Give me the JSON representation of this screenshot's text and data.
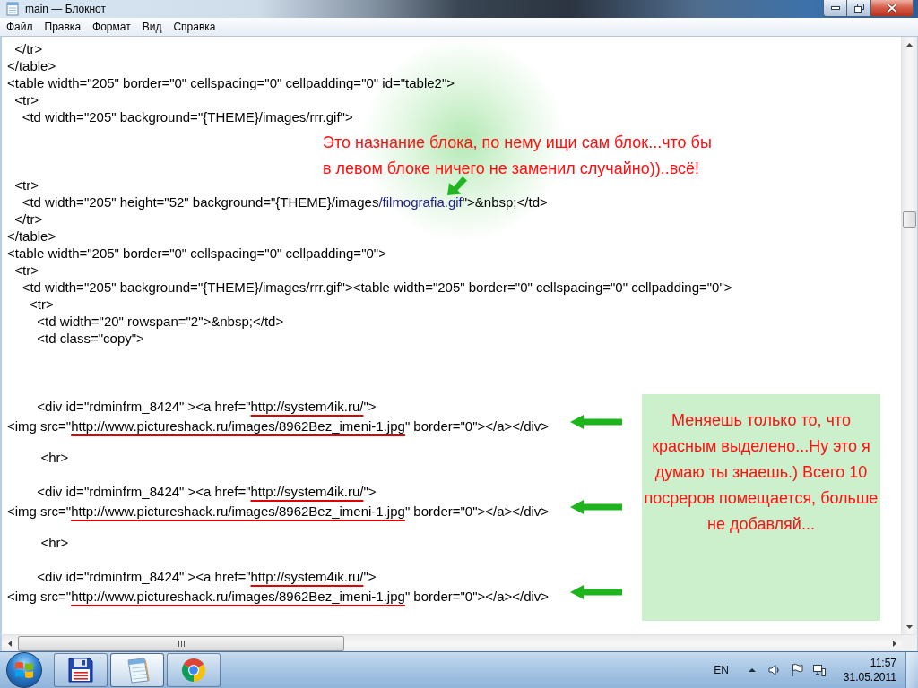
{
  "window": {
    "title": "main — Блокнот"
  },
  "menu": [
    "Файл",
    "Правка",
    "Формат",
    "Вид",
    "Справка"
  ],
  "editor": {
    "lines": [
      {
        "kind": "code",
        "text": "  </tr>",
        "arrow": false
      },
      {
        "kind": "code",
        "text": "</table>",
        "arrow": false
      },
      {
        "kind": "code",
        "text": "<table width=\"205\" border=\"0\" cellspacing=\"0\" cellpadding=\"0\" id=\"table2\">",
        "arrow": false
      },
      {
        "kind": "code",
        "text": "  <tr>",
        "arrow": false
      },
      {
        "kind": "code",
        "text": "    <td width=\"205\" background=\"{THEME}/images/rrr.gif\">",
        "arrow": false
      },
      {
        "kind": "blank"
      },
      {
        "kind": "blank"
      },
      {
        "kind": "blank"
      },
      {
        "kind": "code",
        "text": "  <tr>",
        "arrow": false
      },
      {
        "kind": "code",
        "parts": [
          {
            "text": "    <td width=\"205\" height=\"52\" background=\"{THEME}/images",
            "kind": "plain"
          },
          {
            "text": "/filmografia.gif",
            "kind": "highlighted"
          },
          {
            "text": "\">&nbsp;</td>",
            "kind": "plain"
          }
        ],
        "arrow": false
      },
      {
        "kind": "code",
        "text": "  </tr>",
        "arrow": false
      },
      {
        "kind": "code",
        "text": "</table>",
        "arrow": false
      },
      {
        "kind": "code",
        "text": "<table width=\"205\" border=\"0\" cellspacing=\"0\" cellpadding=\"0\">",
        "arrow": false
      },
      {
        "kind": "code",
        "text": "  <tr>",
        "arrow": false
      },
      {
        "kind": "code",
        "text": "    <td width=\"205\" background=\"{THEME}/images/rrr.gif\"><table width=\"205\" border=\"0\" cellspacing=\"0\" cellpadding=\"0\">",
        "arrow": false
      },
      {
        "kind": "code",
        "text": "      <tr>",
        "arrow": false
      },
      {
        "kind": "code",
        "text": "        <td width=\"20\" rowspan=\"2\">&nbsp;</td>",
        "arrow": false
      },
      {
        "kind": "code",
        "text": "        <td class=\"copy\">",
        "arrow": false
      },
      {
        "kind": "blank"
      },
      {
        "kind": "blank"
      },
      {
        "kind": "blank"
      },
      {
        "kind": "code",
        "parts": [
          {
            "text": "        <div id=\"rdminfrm_8424\" ><a href=\"",
            "kind": "plain"
          },
          {
            "text": "http://system4ik.ru/",
            "kind": "underlined"
          },
          {
            "text": "\">",
            "kind": "plain"
          }
        ],
        "arrow": false
      },
      {
        "kind": "code",
        "parts": [
          {
            "text": "<img src=\"",
            "kind": "plain"
          },
          {
            "text": "http://www.pictureshack.ru/images/8962Bez_imeni-1.jpg",
            "kind": "underlined"
          },
          {
            "text": "\" border=\"0\"></a></div>",
            "kind": "plain"
          }
        ],
        "arrow": true
      },
      {
        "kind": "blank"
      },
      {
        "kind": "code",
        "text": "         <hr>",
        "arrow": false
      },
      {
        "kind": "blank"
      },
      {
        "kind": "code",
        "parts": [
          {
            "text": "        <div id=\"rdminfrm_8424\" ><a href=\"",
            "kind": "plain"
          },
          {
            "text": "http://system4ik.ru/",
            "kind": "underlined"
          },
          {
            "text": "\">",
            "kind": "plain"
          }
        ],
        "arrow": false
      },
      {
        "kind": "code",
        "parts": [
          {
            "text": "<img src=\"",
            "kind": "plain"
          },
          {
            "text": "http://www.pictureshack.ru/images/8962Bez_imeni-1.jpg",
            "kind": "underlined"
          },
          {
            "text": "\" border=\"0\"></a></div>",
            "kind": "plain"
          }
        ],
        "arrow": true
      },
      {
        "kind": "blank"
      },
      {
        "kind": "code",
        "text": "         <hr>",
        "arrow": false
      },
      {
        "kind": "blank"
      },
      {
        "kind": "code",
        "parts": [
          {
            "text": "        <div id=\"rdminfrm_8424\" ><a href=\"",
            "kind": "plain"
          },
          {
            "text": "http://system4ik.ru/",
            "kind": "underlined"
          },
          {
            "text": "\">",
            "kind": "plain"
          }
        ],
        "arrow": false
      },
      {
        "kind": "code",
        "parts": [
          {
            "text": "<img src=\"",
            "kind": "plain"
          },
          {
            "text": "http://www.pictureshack.ru/images/8962Bez_imeni-1.jpg",
            "kind": "underlined"
          },
          {
            "text": "\" border=\"0\"></a></div>",
            "kind": "plain"
          }
        ],
        "arrow": true
      }
    ],
    "callout": {
      "lines": [
        "Это назнание блока, по нему ищи сам блок...что бы",
        "в левом блоке ничего не заменил случайно))..всё!"
      ]
    },
    "note": {
      "lines": [
        "Меняешь только то, что",
        "красным выделено...Ну это я",
        "думаю ты знаешь.) Всего 10",
        "посреров помещается, больше",
        "не добавляй..."
      ]
    }
  },
  "taskbar": {
    "apps": [
      {
        "kind": "floppy",
        "selected": false
      },
      {
        "kind": "notepad",
        "selected": true
      },
      {
        "kind": "ring",
        "selected": false
      }
    ],
    "language": "EN",
    "time": "11:57",
    "date": "31.05.2011"
  }
}
